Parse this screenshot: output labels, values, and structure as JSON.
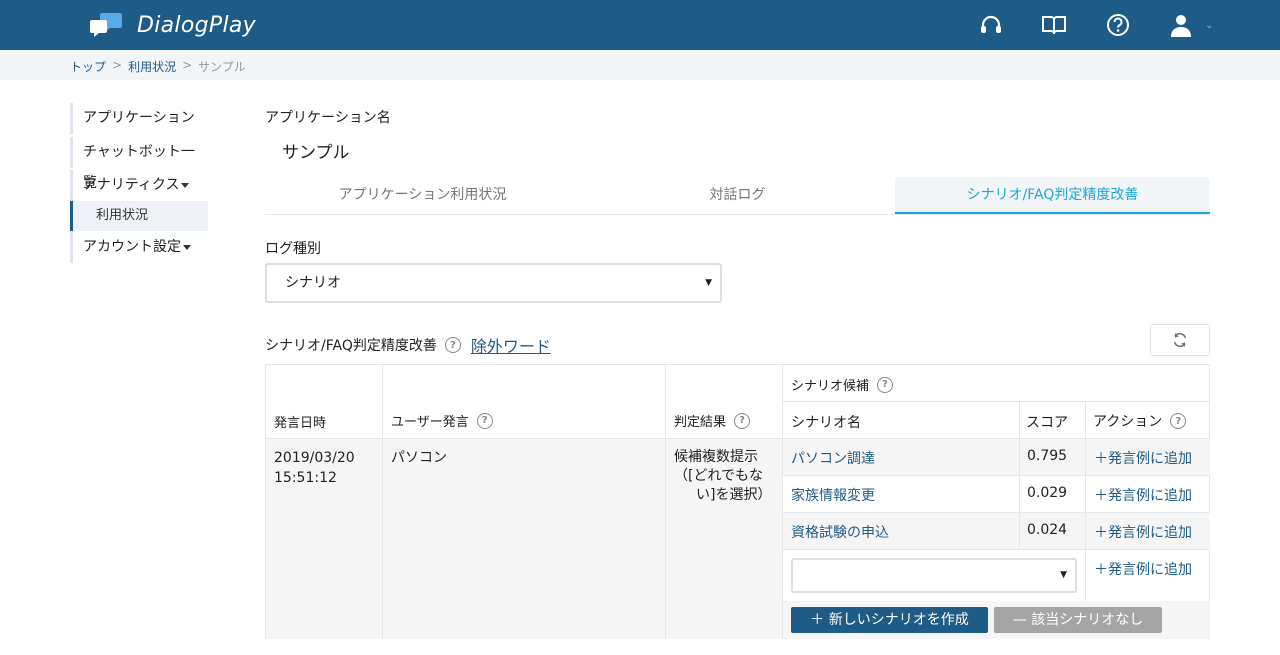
{
  "header": {
    "app_name": "DialogPlay",
    "icons": [
      "headset-icon",
      "book-icon",
      "help-icon",
      "user-icon"
    ]
  },
  "breadcrumb": {
    "items": [
      "トップ",
      "利用状況",
      "サンプル"
    ],
    "separator": ">"
  },
  "sidebar": {
    "items": [
      {
        "label": "アプリケーション"
      },
      {
        "label": "チャットボット一覧"
      },
      {
        "label": "アナリティクス"
      },
      {
        "label": "利用状況"
      },
      {
        "label": "アカウント設定"
      }
    ]
  },
  "main": {
    "app_label": "アプリケーション名",
    "app_value": "サンプル",
    "tabs": [
      {
        "label": "アプリケーション利用状況"
      },
      {
        "label": "対話ログ"
      },
      {
        "label": "シナリオ/FAQ判定精度改善"
      }
    ],
    "log_type_label": "ログ種別",
    "log_type_value": "シナリオ",
    "section_title": "シナリオ/FAQ判定精度改善",
    "exclude_word_link": "除外ワード"
  },
  "table": {
    "headers": {
      "datetime": "発言日時",
      "user_utterance": "ユーザー発言",
      "judgement": "判定結果",
      "candidates": "シナリオ候補",
      "scenario_name": "シナリオ名",
      "score": "スコア",
      "action": "アクション"
    },
    "row": {
      "date": "2019/03/20",
      "time": "15:51:12",
      "utterance": "パソコン",
      "judgement_1": "候補複数提示",
      "judgement_2": "（[どれでもな",
      "judgement_3": "い]を選択）"
    },
    "candidates": [
      {
        "name": "パソコン調達",
        "score": "0.795",
        "action": "＋発言例に追加"
      },
      {
        "name": "家族情報変更",
        "score": "0.029",
        "action": "＋発言例に追加"
      },
      {
        "name": "資格試験の申込",
        "score": "0.024",
        "action": "＋発言例に追加"
      }
    ],
    "select_action": "＋発言例に追加",
    "create_button": "＋ 新しいシナリオを作成",
    "none_button": "— 該当シナリオなし"
  },
  "colors": {
    "header_bg": "#1e5b87",
    "accent": "#1ba7d6",
    "link": "#1e5b87"
  }
}
